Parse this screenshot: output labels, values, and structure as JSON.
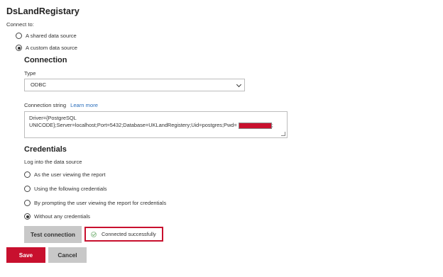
{
  "page_title": "DsLandRegistary",
  "connect_to": {
    "label": "Connect to:",
    "options": [
      "A shared data source",
      "A custom data source"
    ],
    "selected_index": 1
  },
  "connection": {
    "heading": "Connection",
    "type_label": "Type",
    "type_value": "ODBC",
    "connection_string_label": "Connection string",
    "learn_more": "Learn more",
    "connection_string_line1": "Driver={PostgreSQL",
    "connection_string_line2": "UNICODE};Server=localhost;Port=5432;Database=UKLandRegistery;Uid=postgres;Pwd=",
    "connection_string_suffix": ";"
  },
  "credentials": {
    "heading": "Credentials",
    "log_into_label": "Log into the data source",
    "options": [
      "As the user viewing the report",
      "Using the following credentials",
      "By prompting the user viewing the report for credentials",
      "Without any credentials"
    ],
    "selected_index": 3
  },
  "actions": {
    "test_connection": "Test connection",
    "status_text": "Connected successfully",
    "save": "Save",
    "cancel": "Cancel"
  },
  "colors": {
    "accent_red": "#c8102e",
    "link_blue": "#2a6ebb",
    "button_gray": "#c8c8c8",
    "success_green": "#7ab57a"
  }
}
